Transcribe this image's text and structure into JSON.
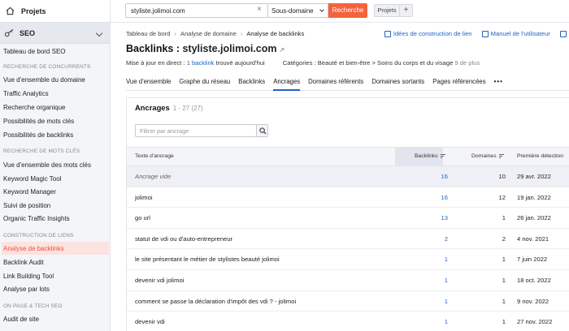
{
  "sidebar": {
    "projets": "Projets",
    "seo": "SEO",
    "items": [
      {
        "label": "Tableau de bord SEO",
        "type": "item"
      },
      {
        "label": "RECHERCHE DE CONCURRENTS",
        "type": "head"
      },
      {
        "label": "Vue d'ensemble du domaine",
        "type": "item"
      },
      {
        "label": "Traffic Analytics",
        "type": "item"
      },
      {
        "label": "Recherche organique",
        "type": "item"
      },
      {
        "label": "Possibilités de mots clés",
        "type": "item"
      },
      {
        "label": "Possibilités de backlinks",
        "type": "item"
      },
      {
        "label": "RECHERCHE DE MOTS CLÉS",
        "type": "head"
      },
      {
        "label": "Vue d'ensemble des mots clés",
        "type": "item"
      },
      {
        "label": "Keyword Magic Tool",
        "type": "item"
      },
      {
        "label": "Keyword Manager",
        "type": "item"
      },
      {
        "label": "Suivi de position",
        "type": "item"
      },
      {
        "label": "Organic Traffic Insights",
        "type": "item"
      },
      {
        "label": "CONSTRUCTION DE LIENS",
        "type": "head"
      },
      {
        "label": "Analyse de backlinks",
        "type": "item",
        "active": true
      },
      {
        "label": "Backlink Audit",
        "type": "item"
      },
      {
        "label": "Link Building Tool",
        "type": "item"
      },
      {
        "label": "Analyse par lots",
        "type": "item"
      },
      {
        "label": "ON PAGE & TECH SEO",
        "type": "head"
      },
      {
        "label": "Audit de site",
        "type": "item"
      }
    ]
  },
  "topbar": {
    "search_value": "styliste.jolimoi.com",
    "scope": "Sous-domaine",
    "search_button": "Recherche",
    "projets_button": "Projets",
    "plus_button": "+"
  },
  "breadcrumb": [
    "Tableau de bord",
    "Analyse de domaine",
    "Analyse de backlinks"
  ],
  "header_links": {
    "ideas": "Idées de construction de lien",
    "manual": "Manuel de l'utilisateur"
  },
  "title": {
    "prefix": "Backlinks : ",
    "domain": "styliste.jolimoi.com"
  },
  "meta": {
    "update_prefix": "Mise à jour en direct : ",
    "backlink_link": "1 backlink",
    "update_suffix": " trouvé aujourd'hui",
    "categories": "Catégories : Beauté et bien-être > Soins du corps et du visage",
    "more": "9 de plus"
  },
  "tabs": [
    "Vue d'ensemble",
    "Graphe du réseau",
    "Backlinks",
    "Ancrages",
    "Domaines référents",
    "Domaines sortants",
    "Pages référencées",
    "•••"
  ],
  "active_tab": 3,
  "panel": {
    "title": "Ancrages",
    "count": "1 - 27 (27)",
    "filter_placeholder": "Filtrer par ancrage"
  },
  "table": {
    "columns": [
      "Texte d'ancrage",
      "Backlinks",
      "Domaines",
      "Première détection"
    ],
    "rows": [
      {
        "anchor": "Ancrage vide",
        "italic": true,
        "backlinks": "16",
        "domains": "10",
        "first_seen": "29 avr. 2022"
      },
      {
        "anchor": "jolimoi",
        "backlinks": "16",
        "domains": "12",
        "first_seen": "19 jan. 2022"
      },
      {
        "anchor": "go url",
        "backlinks": "13",
        "domains": "1",
        "first_seen": "26 jan. 2022"
      },
      {
        "anchor": "statut de vdi ou d'auto-entrepreneur",
        "backlinks": "2",
        "domains": "2",
        "first_seen": "4 nov. 2021"
      },
      {
        "anchor": "le site présentant le métier de stylistes beauté jolimoi",
        "backlinks": "1",
        "domains": "1",
        "first_seen": "7 juin 2022"
      },
      {
        "anchor": "devenir vdi jolimoi",
        "backlinks": "1",
        "domains": "1",
        "first_seen": "18 oct. 2022"
      },
      {
        "anchor": "comment se passe la déclaration d'impôt des vdi ? - jolimoi",
        "backlinks": "1",
        "domains": "1",
        "first_seen": "9 nov. 2022"
      },
      {
        "anchor": "devenir vdi",
        "backlinks": "1",
        "domains": "1",
        "first_seen": "27 nov. 2022"
      }
    ]
  },
  "colors": {
    "accent": "#f5633e",
    "link": "#1e63c4",
    "active_bg": "#fbe3e1"
  }
}
